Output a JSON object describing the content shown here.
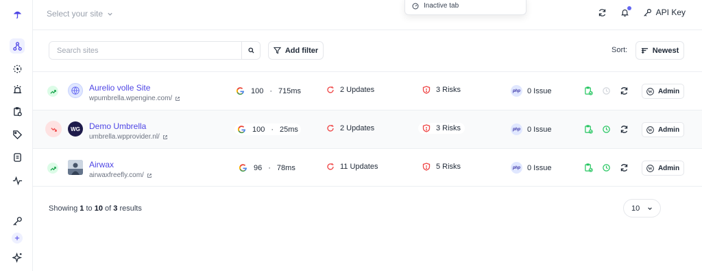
{
  "topbar": {
    "site_select_placeholder": "Select your site",
    "dropdown_item": "Inactive tab",
    "api_key_label": "API Key"
  },
  "toolbar": {
    "search_placeholder": "Search sites",
    "add_filter_label": "Add filter",
    "sort_label": "Sort:",
    "sort_value": "Newest"
  },
  "sites": [
    {
      "name": "Aurelio volle Site",
      "url": "wpumbrella.wpengine.com/",
      "trend": "up",
      "avatar": "globe",
      "score": "100",
      "speed": "715ms",
      "updates": "2 Updates",
      "risks": "3 Risks",
      "php_badge": "php",
      "php_issues": "0 Issue",
      "backup_active": false,
      "admin_label": "Admin"
    },
    {
      "name": "Demo Umbrella",
      "url": "umbrella.wpprovider.nl/",
      "trend": "down",
      "avatar": "WG",
      "score": "100",
      "speed": "25ms",
      "updates": "2 Updates",
      "risks": "3 Risks",
      "php_badge": "php",
      "php_issues": "0 Issue",
      "backup_active": true,
      "admin_label": "Admin"
    },
    {
      "name": "Airwax",
      "url": "airwaxfreefly.com/",
      "trend": "up",
      "avatar": "photo",
      "score": "96",
      "speed": "78ms",
      "updates": "11 Updates",
      "risks": "5 Risks",
      "php_badge": "php",
      "php_issues": "0 Issue",
      "backup_active": true,
      "admin_label": "Admin"
    }
  ],
  "pagination": {
    "showing_label": "Showing",
    "from": "1",
    "to_label": "to",
    "to": "10",
    "of_label": "of",
    "total": "3",
    "results_label": "results",
    "per_page": "10"
  },
  "colors": {
    "accent": "#4f46e5",
    "success": "#22c55e",
    "danger": "#ef4444",
    "muted": "#9aa1ad"
  },
  "icons": {
    "sidebar": [
      "umbrella-logo-icon",
      "sites-network-icon",
      "monitor-icon",
      "alert-icon",
      "clipboard-icon",
      "tag-icon",
      "backup-icon",
      "activity-icon",
      "key-icon",
      "add-icon",
      "sparkle-icon"
    ]
  }
}
